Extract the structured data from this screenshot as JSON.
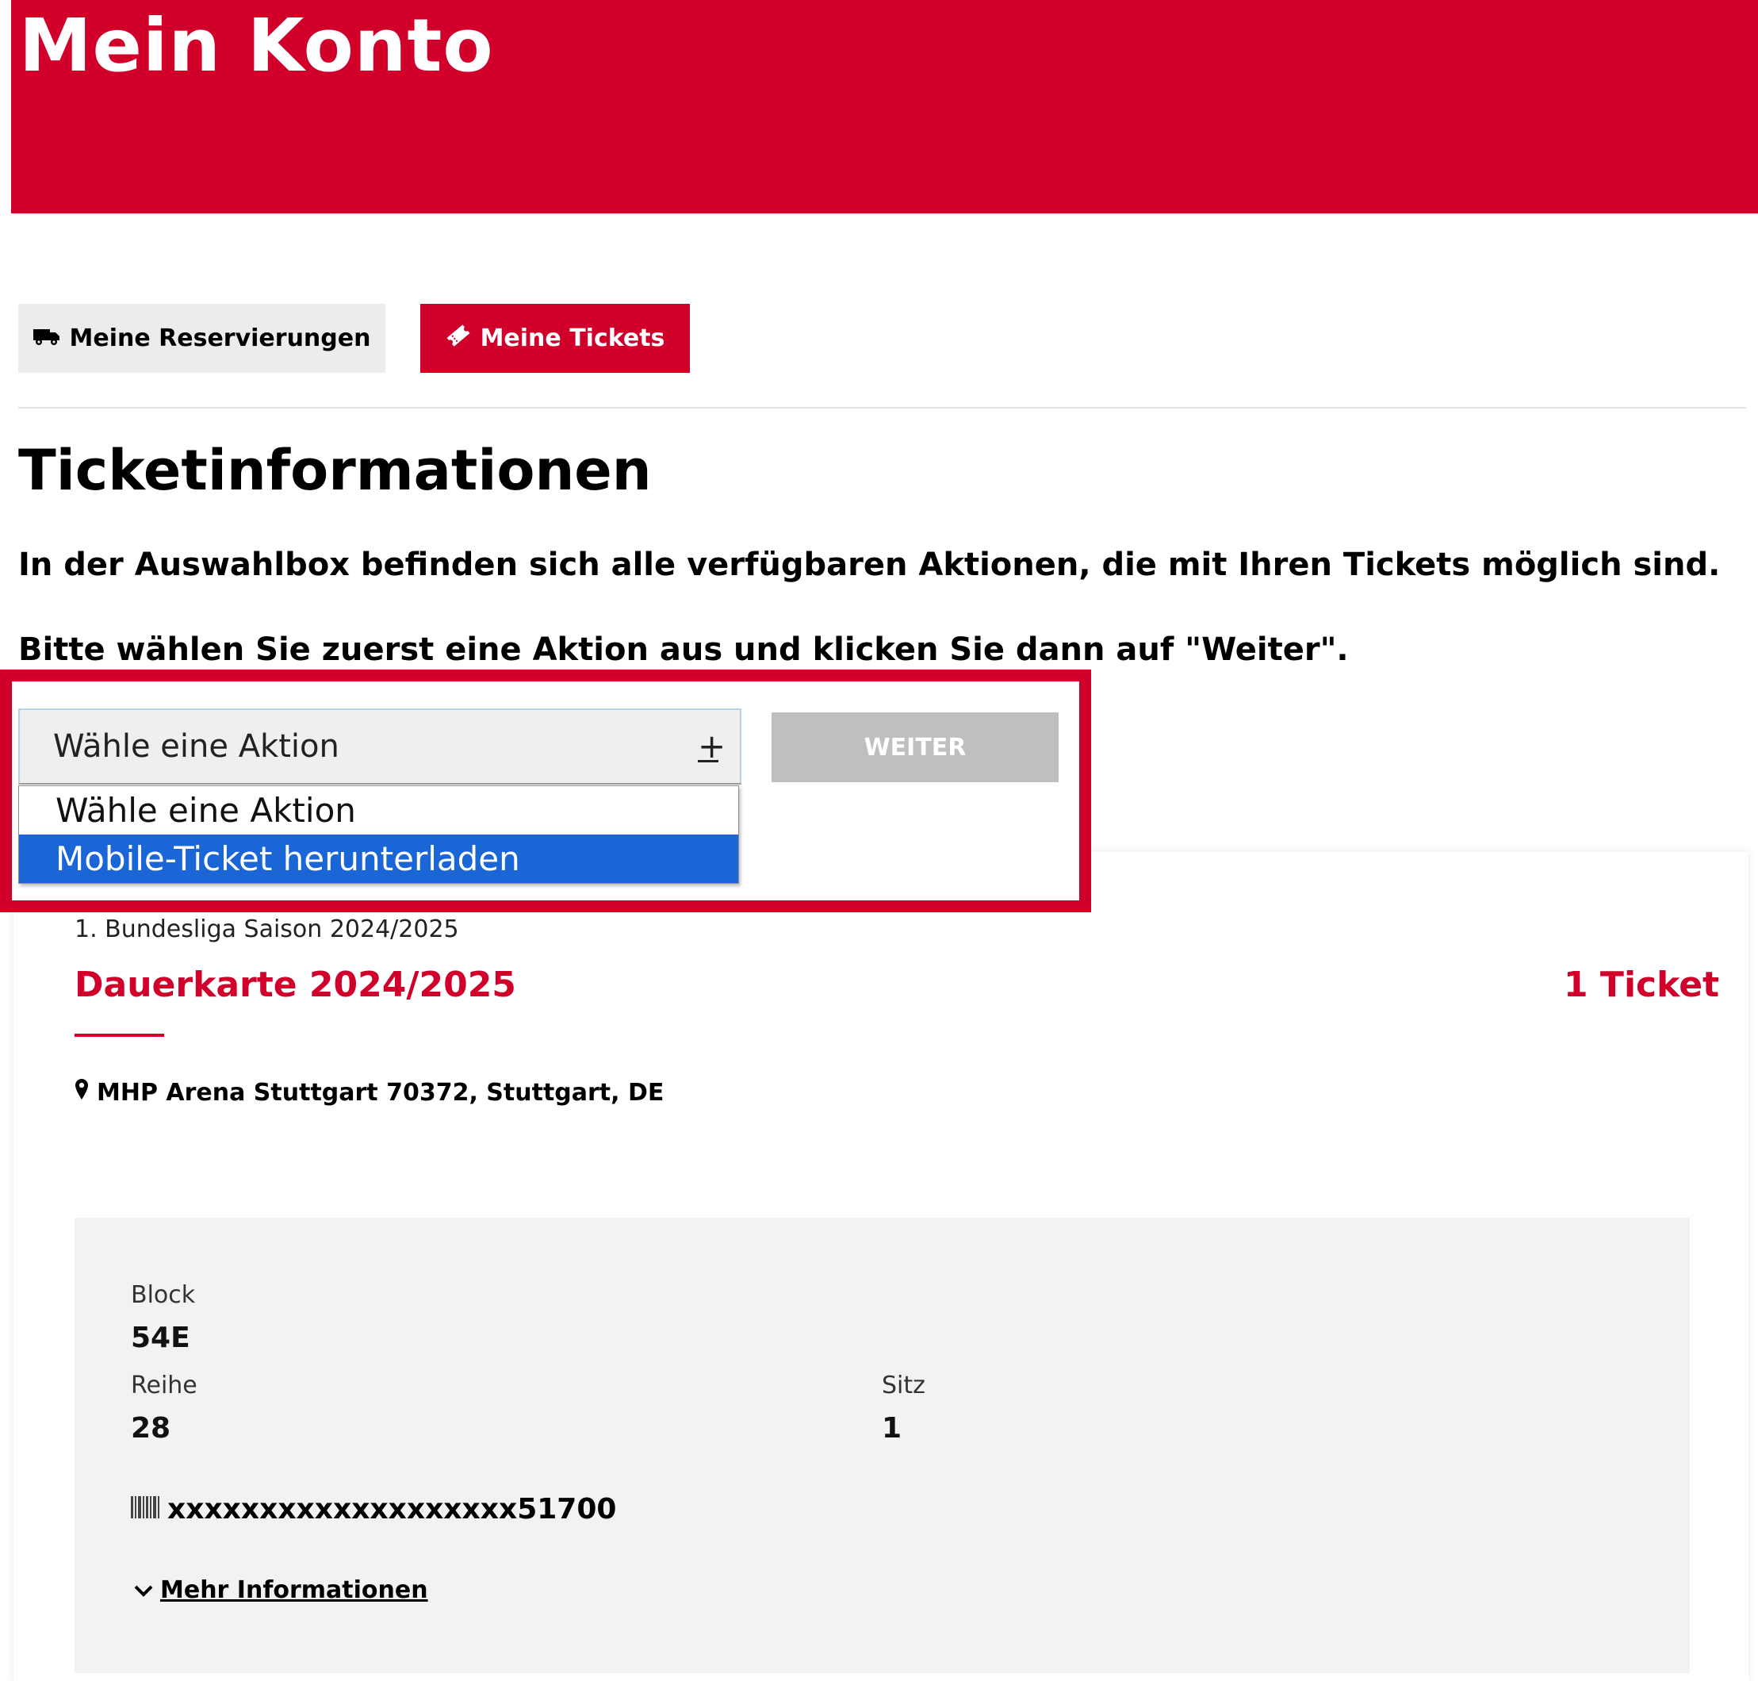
{
  "header": {
    "title": "Mein Konto"
  },
  "tabs": {
    "reservations": {
      "label": "Meine Reservierungen",
      "icon": "truck-icon"
    },
    "tickets": {
      "label": "Meine Tickets",
      "icon": "ticket-icon"
    }
  },
  "page": {
    "title": "Ticketinformationen",
    "intro": "In der Auswahlbox befinden sich alle verfügbaren Aktionen, die mit Ihren Tickets möglich sind.",
    "instruction": "Bitte wählen Sie zuerst eine Aktion aus und klicken Sie dann auf \"Weiter\"."
  },
  "action_select": {
    "value": "Wähle eine Aktion",
    "options": [
      "Wähle eine Aktion",
      "Mobile-Ticket herunterladen"
    ],
    "highlighted_option": "Mobile-Ticket herunterladen"
  },
  "weiter_button": {
    "label": "WEITER"
  },
  "ticket": {
    "league": "1. Bundesliga Saison 2024/2025",
    "event": "Dauerkarte 2024/2025",
    "count": "1 Ticket",
    "venue": "MHP Arena Stuttgart 70372, Stuttgart, DE",
    "block_label": "Block",
    "block_value": "54E",
    "row_label": "Reihe",
    "row_value": "28",
    "seat_label": "Sitz",
    "seat_value": "1",
    "barcode": "xxxxxxxxxxxxxxxxxxx51700",
    "more_info": "Mehr Informationen"
  },
  "colors": {
    "brand": "#d0002b",
    "highlight_option": "#1a66d6",
    "button_disabled": "#bfbfbf"
  }
}
